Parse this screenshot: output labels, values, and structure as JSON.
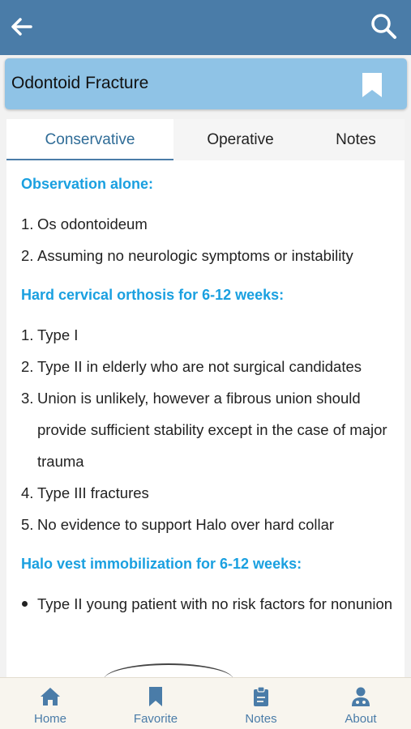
{
  "header": {
    "back_icon": "arrow-left-icon",
    "search_icon": "search-icon",
    "color": "#4a7ca8"
  },
  "title_card": {
    "title": "Odontoid Fracture",
    "bookmark_icon": "bookmark-icon"
  },
  "tabs": [
    {
      "label": "Conservative",
      "active": true
    },
    {
      "label": "Operative",
      "active": false
    },
    {
      "label": "Notes",
      "active": false
    }
  ],
  "sections": [
    {
      "heading": "Observation alone:",
      "items": [
        {
          "num": "1.",
          "text": "Os odontoideum"
        },
        {
          "num": "2.",
          "text": "Assuming no neurologic symptoms or instability"
        }
      ]
    },
    {
      "heading": "Hard cervical orthosis for 6-12 weeks:",
      "items": [
        {
          "num": "1.",
          "text": "Type I"
        },
        {
          "num": "2.",
          "text": "Type II in elderly who are not surgical candidates"
        },
        {
          "num": "3.",
          "text": "Union is unlikely, however a fibrous union should provide sufficient stability except in the case of major trauma"
        },
        {
          "num": "4.",
          "text": "Type III fractures"
        },
        {
          "num": "5.",
          "text": "No evidence to support Halo over hard collar"
        }
      ]
    },
    {
      "heading": "Halo vest immobilization for 6-12 weeks:",
      "bullets": [
        "Type II young patient with no risk factors for nonunion"
      ]
    }
  ],
  "bottom_nav": [
    {
      "label": "Home",
      "icon": "home-icon"
    },
    {
      "label": "Favorite",
      "icon": "bookmark-icon"
    },
    {
      "label": "Notes",
      "icon": "clipboard-icon"
    },
    {
      "label": "About",
      "icon": "doctor-icon"
    }
  ],
  "colors": {
    "heading": "#1aa0e0",
    "title_card": "#8fc3e6",
    "nav_label": "#4a7ca8"
  }
}
